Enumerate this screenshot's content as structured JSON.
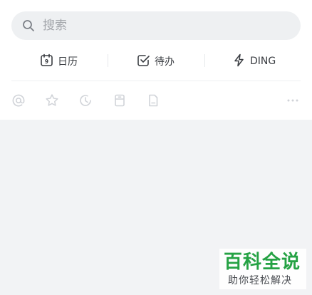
{
  "search": {
    "placeholder": "搜索",
    "icon": "search-icon"
  },
  "quick_actions": [
    {
      "label": "日历",
      "icon": "calendar-icon"
    },
    {
      "label": "待办",
      "icon": "todo-check-icon"
    },
    {
      "label": "DING",
      "icon": "lightning-icon"
    }
  ],
  "filters": [
    {
      "icon": "at-mention-icon"
    },
    {
      "icon": "star-icon"
    },
    {
      "icon": "recent-clock-icon"
    },
    {
      "icon": "archive-icon"
    },
    {
      "icon": "document-icon"
    },
    {
      "icon": "more-icon"
    }
  ],
  "watermark": {
    "title": "百科全说",
    "subtitle": "助你轻松解决"
  },
  "colors": {
    "background": "#f2f3f5",
    "panel": "#ffffff",
    "search_bg": "#eef0f2",
    "text": "#3a3d42",
    "muted_icon": "#d0d3d8",
    "watermark_green": "#25a244"
  }
}
